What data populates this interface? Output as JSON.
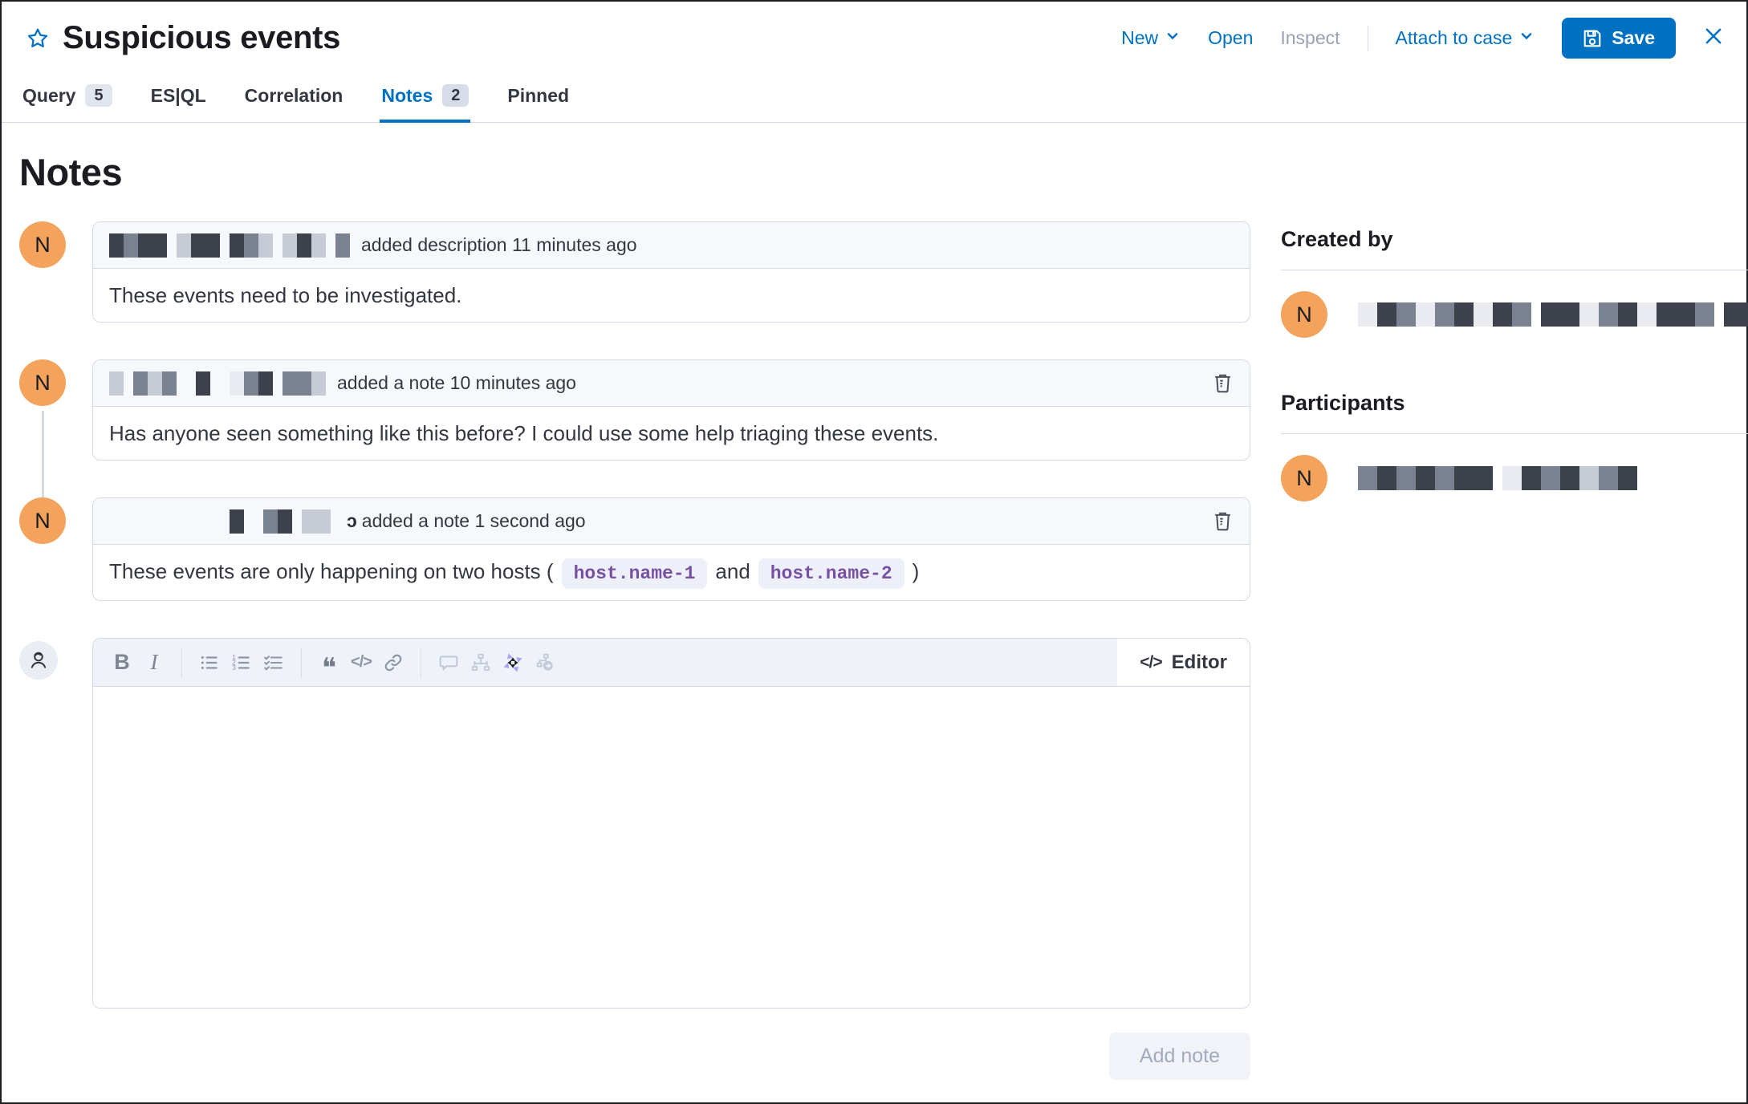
{
  "colors": {
    "accent_blue": "#0071C2",
    "avatar_orange": "#F3A35C",
    "code_purple": "#7750A2",
    "border": "#D3DAE6"
  },
  "window": {
    "title": "Suspicious events",
    "actions": {
      "new": "New",
      "open": "Open",
      "inspect": "Inspect",
      "attach_to_case": "Attach to case",
      "save": "Save"
    }
  },
  "tabs": [
    {
      "label": "Query",
      "badge": "5",
      "active": false
    },
    {
      "label": "ES|QL",
      "active": false
    },
    {
      "label": "Correlation",
      "active": false
    },
    {
      "label": "Notes",
      "badge": "2",
      "active": true
    },
    {
      "label": "Pinned",
      "active": false
    }
  ],
  "notes": {
    "heading": "Notes",
    "items": [
      {
        "avatar": "N",
        "author_redacted": true,
        "mosaic": "dmdd ldd dml ldl m",
        "header_text": "added description 11 minutes ago",
        "body": "These events need to be investigated.",
        "deletable": false
      },
      {
        "avatar": "N",
        "author_redacted": true,
        "mosaic": "l mlm  d  xmd mml",
        "header_text": "added a note 10 minutes ago",
        "body": "Has anyone seen something like this before? I could use some help triaging these events.",
        "deletable": true
      },
      {
        "avatar": "N",
        "author_redacted": true,
        "mosaic": "d  md ll",
        "name_tail": "ɔ",
        "header_text": "added a note 1 second ago",
        "body_parts": {
          "prefix": "These events are only happening on two hosts (",
          "code1": "host.name-1",
          "mid": "and",
          "code2": "host.name-2",
          "suffix": ")"
        },
        "deletable": true
      }
    ]
  },
  "editor": {
    "toolbar_icons": [
      "bold",
      "italic",
      "unordered-list",
      "ordered-list",
      "task-list",
      "quote",
      "code",
      "link",
      "comment",
      "visualize",
      "ai-assistant",
      "investigate"
    ],
    "toggle_label": "Editor",
    "value": "",
    "add_note_label": "Add note"
  },
  "sidebar": {
    "created_by": {
      "heading": "Created by",
      "avatar": "N",
      "name_redacted": true,
      "mosaic": "xdmxmdxdm ddxmdxddm dd"
    },
    "participants": {
      "heading": "Participants",
      "avatar": "N",
      "name_redacted": true,
      "mosaic": "mdmdmdd xdmdlmd"
    }
  }
}
